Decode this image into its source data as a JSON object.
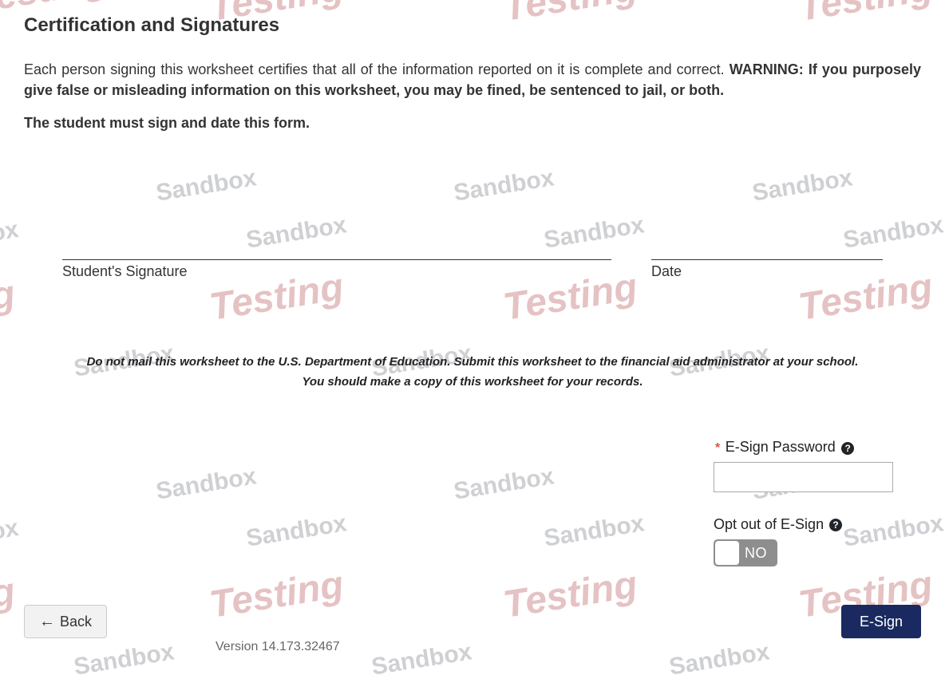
{
  "section_title": "Certification and Signatures",
  "intro_plain": "Each person signing this worksheet certifies that all of the information reported on it is complete and correct. ",
  "intro_bold": "WARNING: If you purposely give false or misleading information on this worksheet, you may be fined, be sentenced to jail, or both.",
  "must_sign": "The student must sign and date this form.",
  "signature": {
    "student_label": "Student's Signature",
    "date_label": "Date"
  },
  "note1": "Do not mail this worksheet to the U.S. Department of Education. Submit this worksheet to the financial aid administrator at your school.",
  "note2": "You should make a copy of this worksheet for your records.",
  "esign": {
    "required_marker": "*",
    "password_label": "E-Sign Password",
    "help_glyph": "?",
    "password_value": "",
    "optout_label": "Opt out of E-Sign",
    "optout_value": "NO"
  },
  "buttons": {
    "back_arrow": "←",
    "back_label": "Back",
    "esign_label": "E-Sign"
  },
  "version": "Version 14.173.32467",
  "watermark": {
    "testing": "Testing",
    "sandbox": "Sandbox",
    "ng": "ng",
    "box": "box"
  }
}
